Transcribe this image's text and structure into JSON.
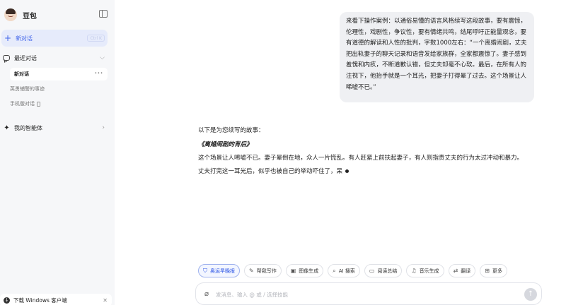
{
  "sidebar": {
    "brand_name": "豆包",
    "new_chat_label": "新对话",
    "new_chat_shortcut": "Ctrl K",
    "recent_label": "最近对话",
    "history": [
      {
        "label": "新对话"
      },
      {
        "label": "英勇辅警的事迹"
      },
      {
        "label": "手机版对话"
      }
    ],
    "agents_label": "我的智能体",
    "download_label": "下载 Windows 客户端"
  },
  "conversation": {
    "user_message": "来看下操作案例：以通俗易懂的语言风格续写这段故事，要有震惊，伦理性，戏剧性，争议性，要有情绪共鸣，结尾呼吁正能量观念，要有道德的解读和人性的批判，字数1000左右：“一个离婚闹剧，丈夫把出轨妻子的聊天记录和语音发给家族群，全家都震惊了。妻子感到羞愧和内疚，不断道歉认错，但丈夫却毫不心软。最后，在所有人的注视下，他抬手就是一个耳光，把妻子打得晕了过去。这个场景让人唏嘘不已。”",
    "assistant_intro": "以下是为您续写的故事：",
    "assistant_title": "《离婚闹剧的背后》",
    "assistant_paragraphs": [
      "这个场景让人唏嘘不已。妻子晕倒在地，众人一片慌乱。有人赶紧上前扶起妻子，有人则指责丈夫的行为太过冲动和暴力。",
      "丈夫打完这一耳光后，似乎也被自己的举动吓住了，呆"
    ]
  },
  "tools": [
    {
      "label": "奥运早晚报",
      "icon": "shield-icon",
      "glyph": "⛉"
    },
    {
      "label": "帮我写作",
      "icon": "pen-icon",
      "glyph": "✎"
    },
    {
      "label": "图像生成",
      "icon": "image-icon",
      "glyph": "▣"
    },
    {
      "label": "AI 搜索",
      "icon": "search-icon",
      "glyph": "⌕"
    },
    {
      "label": "阅读总结",
      "icon": "read-icon",
      "glyph": "▭"
    },
    {
      "label": "音乐生成",
      "icon": "music-icon",
      "glyph": "♫"
    },
    {
      "label": "翻译",
      "icon": "translate-icon",
      "glyph": "⇄"
    },
    {
      "label": "更多",
      "icon": "grid-icon",
      "glyph": "⊞"
    }
  ],
  "composer": {
    "placeholder": "发消息、输入 @ 或 / 选择技能"
  },
  "colors": {
    "accent": "#3f63ea",
    "sidebar_bg": "#f6f7f9",
    "bubble_bg": "#eff0f3"
  }
}
